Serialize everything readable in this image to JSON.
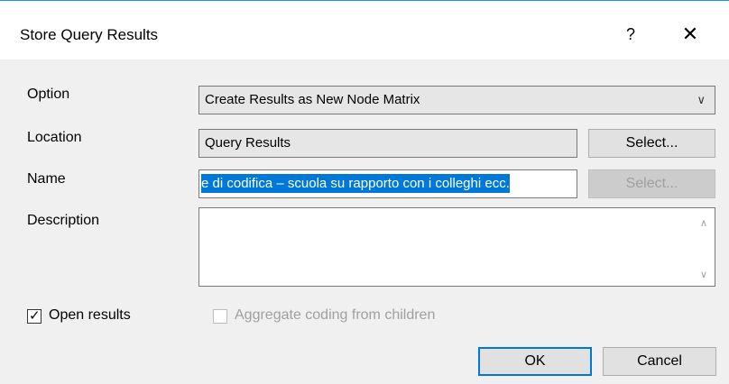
{
  "window": {
    "title": "Store Query Results",
    "help_glyph": "?",
    "close_glyph": "✕"
  },
  "form": {
    "option_label": "Option",
    "option_value": "Create Results as New Node Matrix",
    "location_label": "Location",
    "location_value": "Query Results",
    "location_select": "Select...",
    "name_label": "Name",
    "name_value": "e di codifica – scuola su rapporto con i colleghi ecc.",
    "name_select": "Select...",
    "description_label": "Description",
    "description_value": ""
  },
  "options": {
    "open_results_label": "Open results",
    "open_results_checked": true,
    "aggregate_label": "Aggregate coding from children",
    "aggregate_checked": false
  },
  "buttons": {
    "ok": "OK",
    "cancel": "Cancel"
  },
  "icons": {
    "combo": "chevron-down-icon",
    "scroll_up": "chevron-up-icon",
    "scroll_down": "chevron-down-icon"
  },
  "colors": {
    "accent": "#0078d7",
    "title_border": "#1e90ff"
  }
}
